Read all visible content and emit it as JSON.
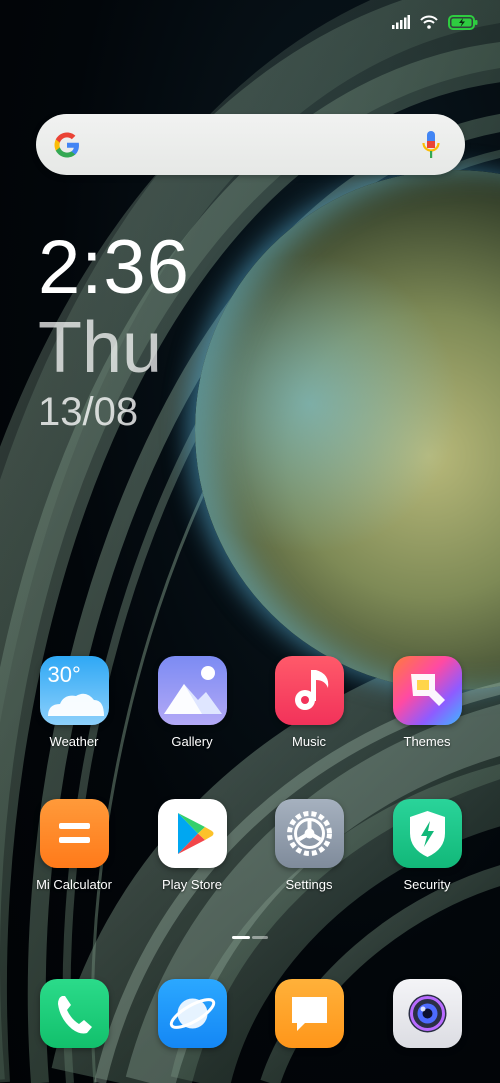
{
  "status_bar": {
    "signal_icon": "signal-icon",
    "wifi_icon": "wifi-icon",
    "battery_icon": "battery-charging-icon",
    "battery_color": "#2ecc40"
  },
  "search_widget": {
    "logo_icon": "google-g-icon",
    "mic_icon": "microphone-icon"
  },
  "clock_widget": {
    "time": "2:36",
    "day": "Thu",
    "date": "13/08"
  },
  "apps": {
    "weather": {
      "label": "Weather",
      "icon_text": "30°",
      "icon": "weather-icon"
    },
    "gallery": {
      "label": "Gallery",
      "icon": "gallery-icon"
    },
    "music": {
      "label": "Music",
      "icon": "music-note-icon"
    },
    "themes": {
      "label": "Themes",
      "icon": "themes-brush-icon"
    },
    "calculator": {
      "label": "Mi Calculator",
      "icon": "calculator-icon"
    },
    "play_store": {
      "label": "Play Store",
      "icon": "play-store-icon"
    },
    "settings": {
      "label": "Settings",
      "icon": "settings-gear-icon"
    },
    "security": {
      "label": "Security",
      "icon": "security-shield-icon"
    }
  },
  "page_indicator": {
    "current_page": 1,
    "total_pages": 2
  },
  "dock": {
    "phone": {
      "icon": "phone-icon"
    },
    "browser": {
      "icon": "browser-icon"
    },
    "messages": {
      "icon": "messages-icon"
    },
    "camera": {
      "icon": "camera-icon"
    }
  }
}
